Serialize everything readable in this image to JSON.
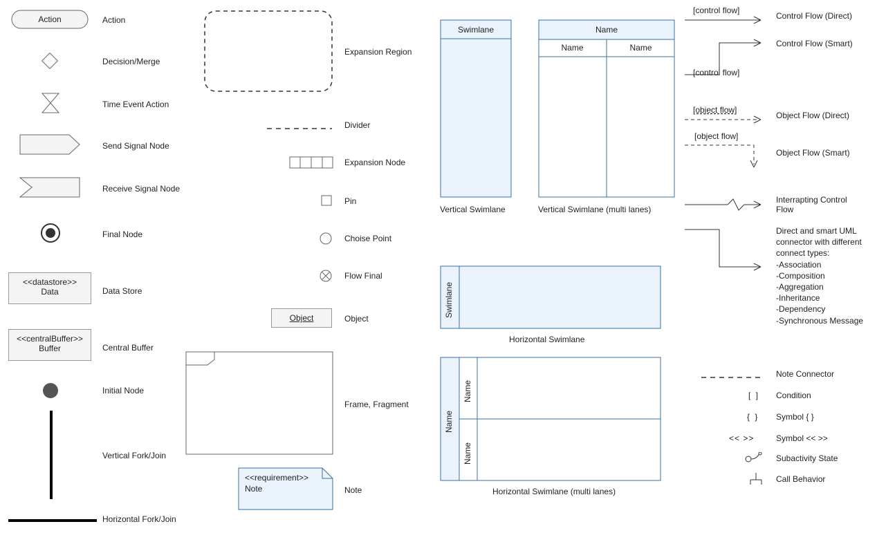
{
  "col1": {
    "action": {
      "shapeText": "Action",
      "label": "Action"
    },
    "decision": {
      "label": "Decision/Merge"
    },
    "timeEvent": {
      "label": "Time Event Action"
    },
    "sendSignal": {
      "label": "Send Signal Node"
    },
    "receiveSignal": {
      "label": "Receive Signal Node"
    },
    "finalNode": {
      "label": "Final Node"
    },
    "dataStore": {
      "stereo": "<<datastore>>",
      "name": "Data",
      "label": "Data Store"
    },
    "centralBuffer": {
      "stereo": "<<centralBuffer>>",
      "name": "Buffer",
      "label": "Central Buffer"
    },
    "initialNode": {
      "label": "Initial Node"
    },
    "vFork": {
      "label": "Vertical Fork/Join"
    },
    "hFork": {
      "label": "Horizontal Fork/Join"
    }
  },
  "col2": {
    "expansionRegion": {
      "label": "Expansion Region"
    },
    "divider": {
      "label": "Divider"
    },
    "expansionNode": {
      "label": "Expansion Node"
    },
    "pin": {
      "label": "Pin"
    },
    "choicePoint": {
      "label": "Choise Point"
    },
    "flowFinal": {
      "label": "Flow Final"
    },
    "object": {
      "shapeText": "Object",
      "label": "Object"
    },
    "frame": {
      "label": "Frame, Fragment"
    },
    "note": {
      "stereo": "<<requirement>>",
      "name": "Note",
      "label": "Note"
    }
  },
  "col3": {
    "vSwim": {
      "header": "Swimlane",
      "label": "Vertical Swimlane"
    },
    "vSwimMulti": {
      "header": "Name",
      "sub1": "Name",
      "sub2": "Name",
      "label": "Vertical Swimlane (multi lanes)"
    },
    "hSwim": {
      "header": "Swimlane",
      "label": "Horizontal Swimlane"
    },
    "hSwimMulti": {
      "header": "Name",
      "sub1": "Name",
      "sub2": "Name",
      "label": "Horizontal Swimlane (multi lanes)"
    }
  },
  "col4": {
    "cfDirect": {
      "tag": "[control flow]",
      "label": "Control Flow (Direct)"
    },
    "cfSmart": {
      "tag": "[control flow]",
      "label": "Control Flow (Smart)"
    },
    "ofDirect": {
      "tag": "[object flow]",
      "label": "Object Flow (Direct)"
    },
    "ofSmart": {
      "tag": "[object flow]",
      "label": "Object Flow (Smart)"
    },
    "interrupt": {
      "label": "Interrapting Control Flow"
    },
    "connectors": {
      "label": "Direct and smart UML connector with different connect types:",
      "items": [
        "-Association",
        "-Composition",
        "-Aggregation",
        "-Inheritance",
        "-Dependency",
        "-Synchronous Message"
      ]
    },
    "noteConnector": {
      "label": "Note Connector"
    },
    "condition": {
      "symbol": "[ ]",
      "label": "Condition"
    },
    "curly": {
      "symbol": "{ }",
      "label": "Symbol { }"
    },
    "angle": {
      "symbol": "<< >>",
      "label": "Symbol << >>"
    },
    "subactivity": {
      "label": "Subactivity State"
    },
    "callBehavior": {
      "label": "Call Behavior"
    }
  }
}
